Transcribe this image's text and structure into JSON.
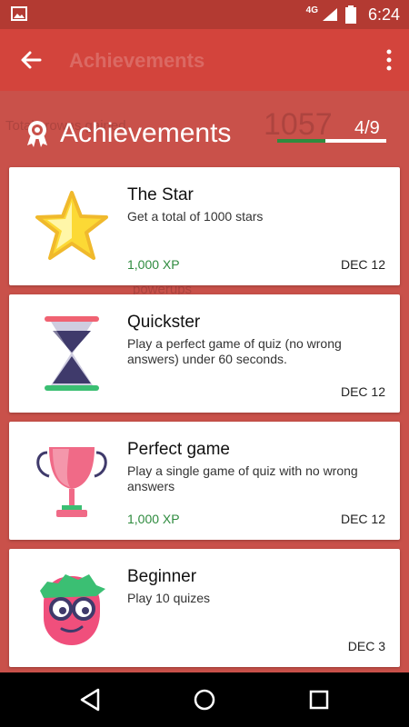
{
  "status": {
    "network": "4G",
    "time": "6:24"
  },
  "app_bar": {
    "title": "Achievements"
  },
  "background": {
    "crowns_label": "Total crowns gained",
    "crowns_value": "1057",
    "powerups_label": "powerups"
  },
  "dialog": {
    "title": "Achievements",
    "count": "4/9",
    "progress": 0.44
  },
  "achievements": [
    {
      "name": "The Star",
      "description": "Get a total of 1000 stars",
      "xp": "1,000 XP",
      "date": "DEC 12"
    },
    {
      "name": "Quickster",
      "description": "Play a perfect game of quiz (no wrong answers) under 60 seconds.",
      "xp": "",
      "date": "DEC 12"
    },
    {
      "name": "Perfect game",
      "description": "Play a single game of quiz with no wrong answers",
      "xp": "1,000 XP",
      "date": "DEC 12"
    },
    {
      "name": "Beginner",
      "description": "Play 10 quizes",
      "xp": "",
      "date": "DEC 3"
    }
  ],
  "colors": {
    "accent": "#d3443c",
    "xp_green": "#2e8b3e"
  }
}
